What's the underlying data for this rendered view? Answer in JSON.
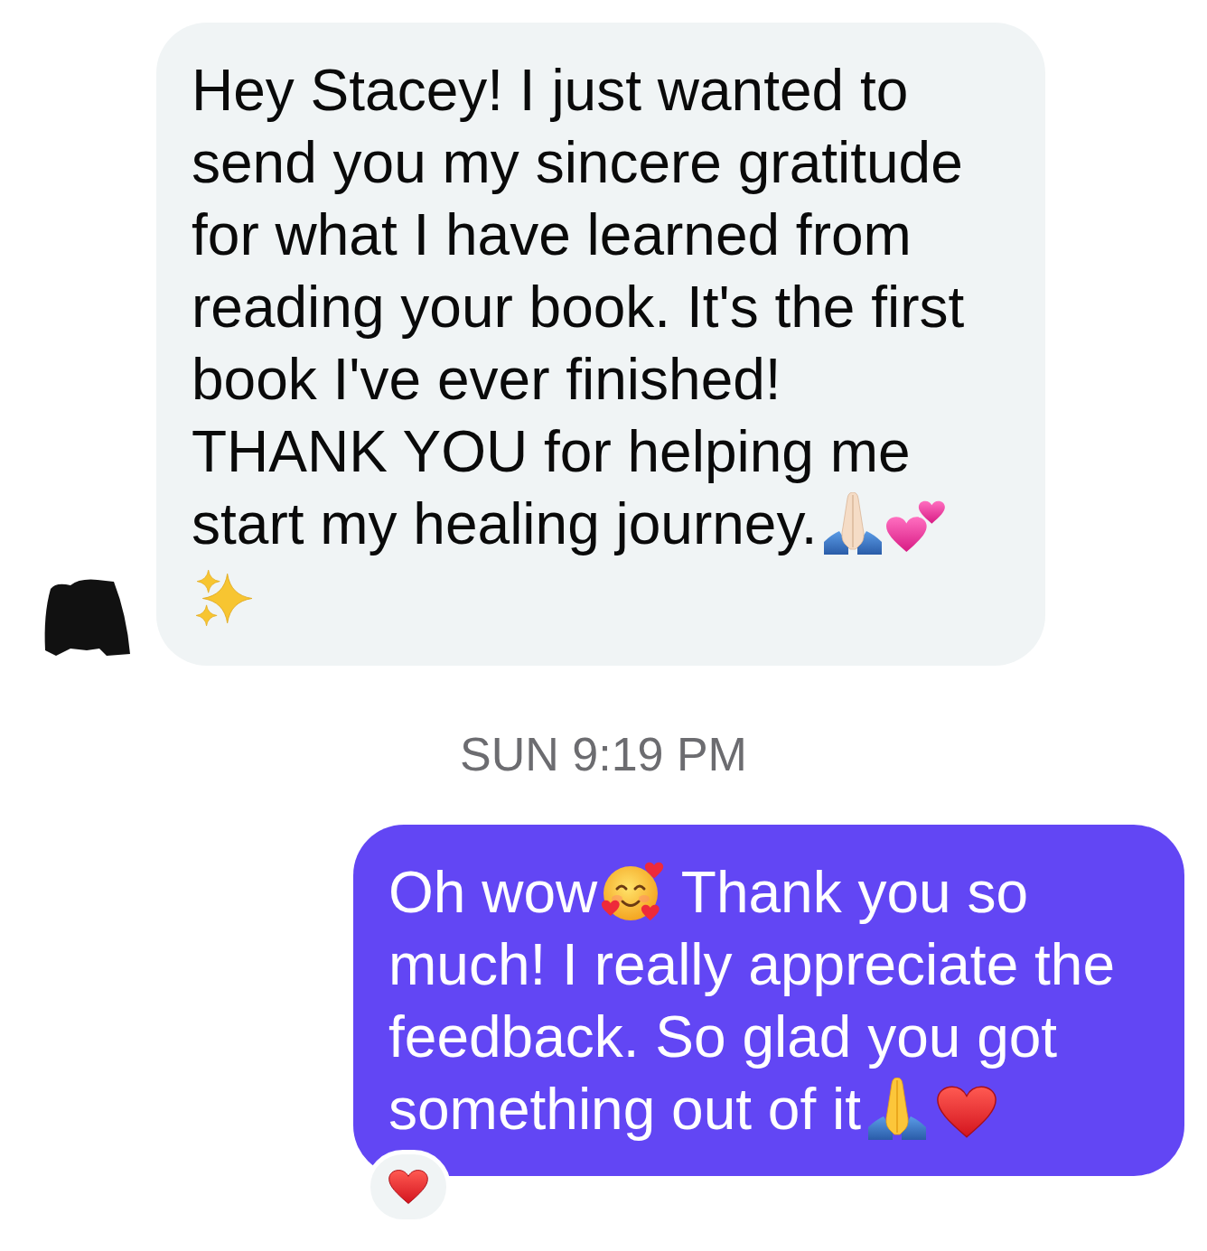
{
  "messages": [
    {
      "kind": "incoming",
      "segments": [
        {
          "kind": "text",
          "text": "Hey Stacey! I just wanted to send you my sincere gratitude for what I have learned from reading your book. It's the first book I've ever finished! THANK YOU for helping me start my healing journey."
        },
        {
          "kind": "prayerlight"
        },
        {
          "kind": "hearts"
        },
        {
          "kind": "sparkles"
        }
      ]
    },
    {
      "kind": "timestamp",
      "text": "SUN 9:19 PM"
    },
    {
      "kind": "outgoing",
      "segments": [
        {
          "kind": "text",
          "text": "Oh wow"
        },
        {
          "kind": "blush"
        },
        {
          "kind": "text",
          "text": "Thank you so much! I really appreciate the feedback. So glad you got something out of it"
        },
        {
          "kind": "prayer"
        },
        {
          "kind": "heart"
        }
      ],
      "reaction": {
        "kind": "heart"
      }
    }
  ]
}
